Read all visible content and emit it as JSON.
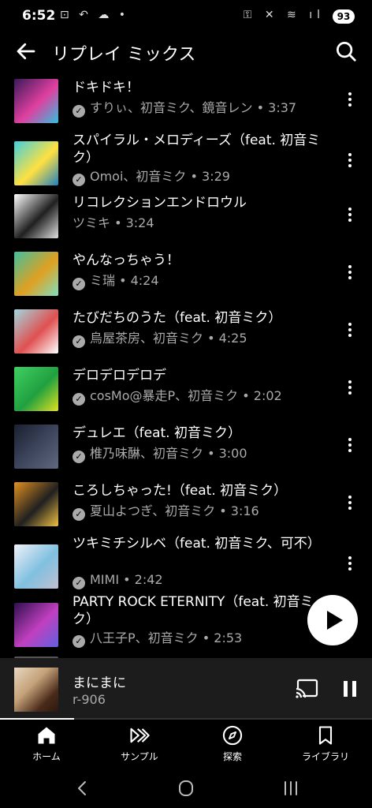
{
  "status_bar": {
    "time": "6:52",
    "left_icons": "⊡ ↶ ☁ •",
    "right_icons": "⚿ ✕ ≋ ıl",
    "battery": "93"
  },
  "header": {
    "title": "リプレイ ミックス",
    "back_icon": "arrow-left-icon",
    "search_icon": "search-icon"
  },
  "tracks": [
    {
      "title": "ドキドキ！",
      "subtitle": "すりぃ、初音ミク、鏡音レン • 3:37",
      "verified": true,
      "thumb_colors": [
        "#3a1a5a",
        "#e040a0",
        "#30c0e0"
      ]
    },
    {
      "title": "スパイラル・メロディーズ（feat. 初音ミク）",
      "subtitle": "Omoi、初音ミク • 3:29",
      "verified": true,
      "thumb_colors": [
        "#40d0e0",
        "#ffe040",
        "#2080c0"
      ]
    },
    {
      "title": "リコレクションエンドロウル",
      "subtitle": "ツミキ • 3:24",
      "verified": false,
      "thumb_colors": [
        "#ffffff",
        "#202020",
        "#e0e0e0"
      ]
    },
    {
      "title": "やんなっちゃう！",
      "subtitle": "ミ瑞 • 4:24",
      "verified": true,
      "thumb_colors": [
        "#40c0a0",
        "#e0a020",
        "#80e0c0"
      ]
    },
    {
      "title": "たびだちのうた（feat. 初音ミク）",
      "subtitle": "烏屋茶房、初音ミク • 4:25",
      "verified": true,
      "thumb_colors": [
        "#a0d8e0",
        "#e05050",
        "#ffffff"
      ]
    },
    {
      "title": "デロデロデロデ",
      "subtitle": "cosMo@暴走P、初音ミク • 2:02",
      "verified": true,
      "thumb_colors": [
        "#40d060",
        "#20a040",
        "#e0e020"
      ]
    },
    {
      "title": "デュレエ（feat. 初音ミク）",
      "subtitle": "椎乃味醂、初音ミク • 3:00",
      "verified": true,
      "thumb_colors": [
        "#1a2030",
        "#404860",
        "#606880"
      ]
    },
    {
      "title": "ころしちゃった!（feat. 初音ミク）",
      "subtitle": "夏山よつぎ、初音ミク • 3:16",
      "verified": true,
      "thumb_colors": [
        "#e09020",
        "#202020",
        "#f0c040"
      ]
    },
    {
      "title": "ツキミチシルベ（feat. 初音ミク、可不）",
      "subtitle": "MIMI • 2:42",
      "verified": true,
      "thumb_colors": [
        "#f0f0f8",
        "#80c0e0",
        "#c0c0d0"
      ]
    },
    {
      "title": "PARTY ROCK ETERNITY（feat. 初音ミク）",
      "subtitle": "八王子P、初音ミク • 2:53",
      "verified": true,
      "thumb_colors": [
        "#301050",
        "#c040c0",
        "#6060e0"
      ]
    }
  ],
  "play_fab_icon": "play-icon",
  "now_playing": {
    "title": "まにまに",
    "artist": "r-906",
    "cast_icon": "cast-icon",
    "pause_icon": "pause-icon",
    "progress": 0.2
  },
  "bottom_nav": [
    {
      "label": "ホーム",
      "icon": "home-icon",
      "active": true
    },
    {
      "label": "サンプル",
      "icon": "samples-icon",
      "active": false
    },
    {
      "label": "探索",
      "icon": "explore-icon",
      "active": false
    },
    {
      "label": "ライブラリ",
      "icon": "library-icon",
      "active": false
    }
  ],
  "system_nav": {
    "back": "back-icon",
    "home": "home-circle-icon",
    "recents": "recents-icon"
  }
}
